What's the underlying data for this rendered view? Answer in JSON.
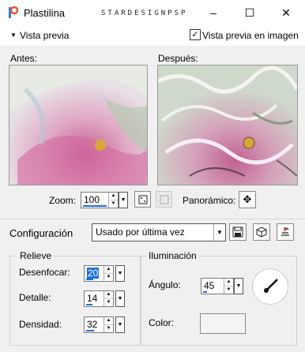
{
  "window": {
    "title": "Plastilina",
    "watermark": "STARDESIGNPSP",
    "minimize": "–",
    "maximize": "☐",
    "close": "✕"
  },
  "toolbar": {
    "preview_toggle": "Vista previa",
    "preview_in_image": "Vista previa en imagen",
    "preview_in_image_checked": true
  },
  "previews": {
    "before_label": "Antes:",
    "after_label": "Después:"
  },
  "zoom": {
    "label": "Zoom:",
    "value": "100",
    "pan_label": "Panorámico:"
  },
  "config": {
    "label": "Configuración",
    "selected": "Usado por última vez"
  },
  "relief": {
    "title": "Relieve",
    "blur": {
      "label": "Desenfocar:",
      "value": "20"
    },
    "detail": {
      "label": "Detalle:",
      "value": "14"
    },
    "density": {
      "label": "Densidad:",
      "value": "32"
    }
  },
  "lighting": {
    "title": "Iluminación",
    "angle": {
      "label": "Ángulo:",
      "value": "45"
    },
    "color": {
      "label": "Color:",
      "swatch": "#f4f4f4"
    }
  }
}
